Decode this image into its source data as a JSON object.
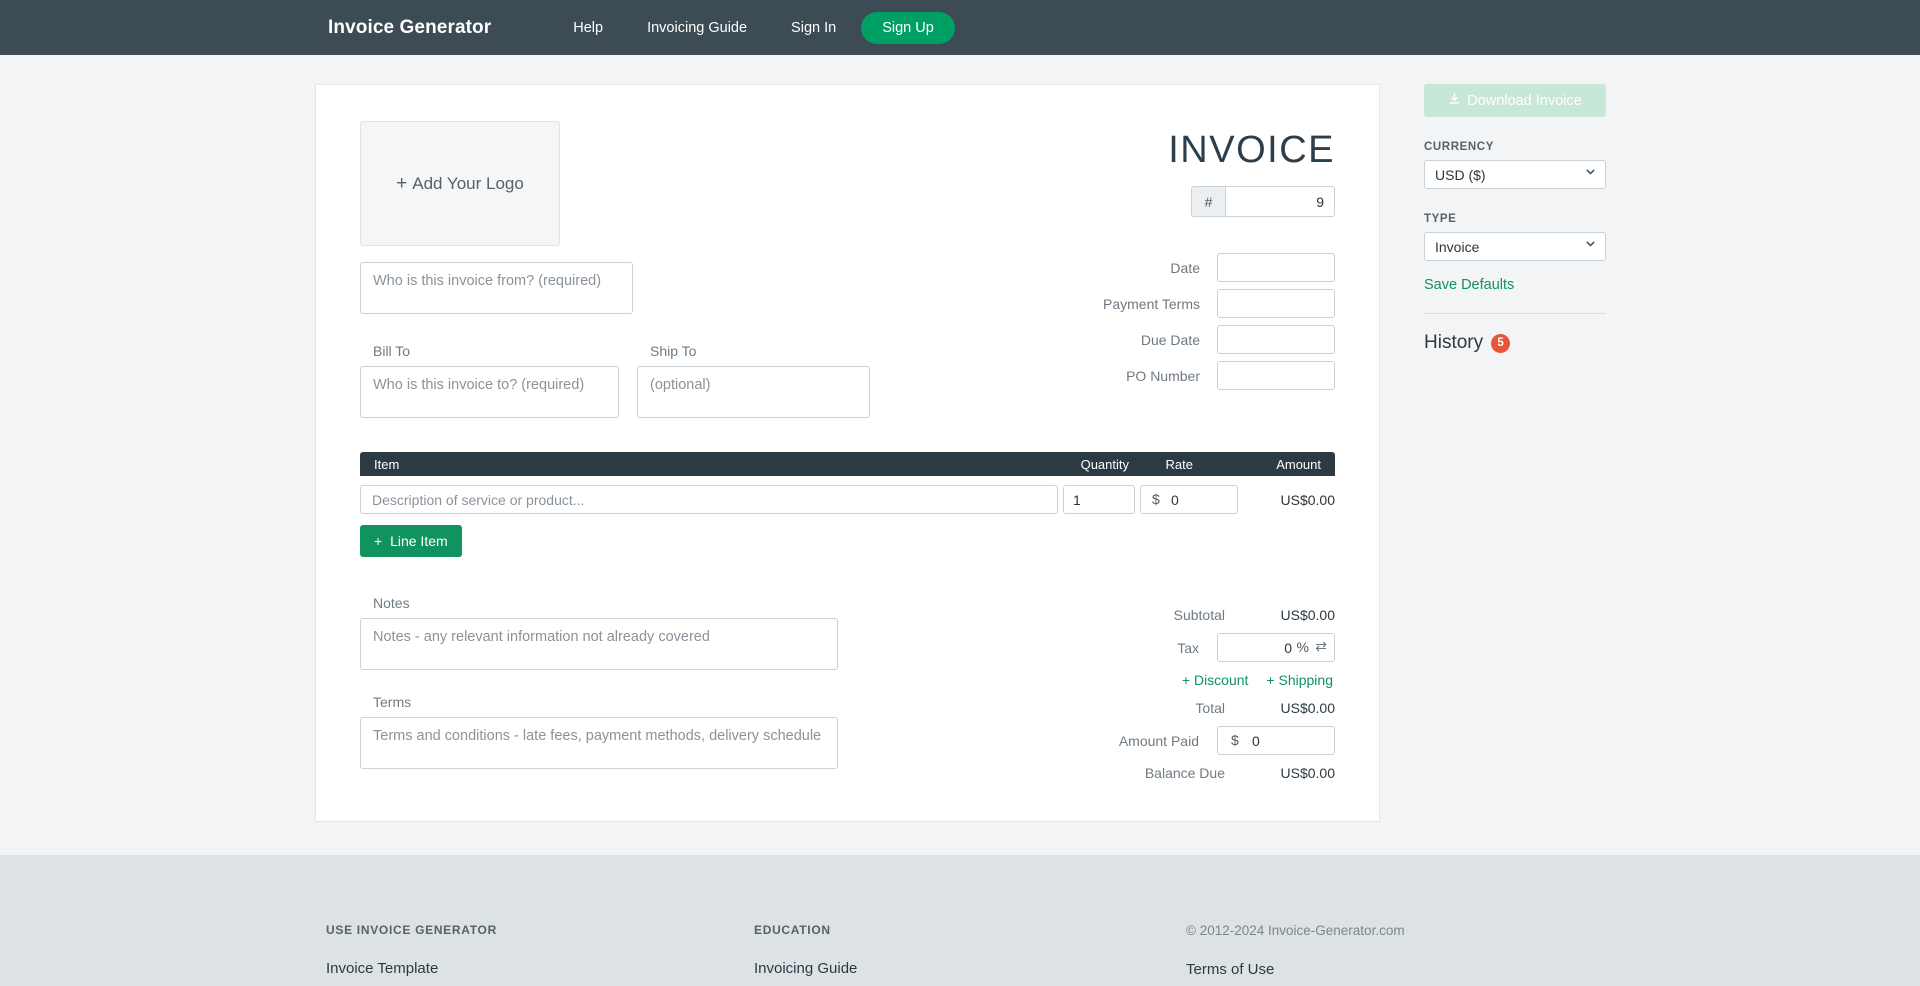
{
  "nav": {
    "brand": "Invoice Generator",
    "links": [
      {
        "label": "Help"
      },
      {
        "label": "Invoicing Guide"
      },
      {
        "label": "Sign In"
      }
    ],
    "signup_label": "Sign Up",
    "accent_green": "#00a064",
    "bar_color": "#3c4b54"
  },
  "invoice": {
    "logo_placeholder": "Add Your Logo",
    "logo_plus": "+",
    "from_placeholder": "Who is this invoice from? (required)",
    "bill_to_label": "Bill To",
    "bill_to_placeholder": "Who is this invoice to? (required)",
    "ship_to_label": "Ship To",
    "ship_to_placeholder": "(optional)",
    "title": "INVOICE",
    "number_prefix": "#",
    "number_value": "9",
    "dates": [
      {
        "label": "Date",
        "value": ""
      },
      {
        "label": "Payment Terms",
        "value": ""
      },
      {
        "label": "Due Date",
        "value": ""
      },
      {
        "label": "PO Number",
        "value": ""
      }
    ],
    "table": {
      "headers": {
        "item": "Item",
        "quantity": "Quantity",
        "rate": "Rate",
        "amount": "Amount"
      },
      "rows": [
        {
          "description_placeholder": "Description of service or product...",
          "quantity": "1",
          "rate_currency": "$",
          "rate": "0",
          "amount": "US$0.00"
        }
      ],
      "add_line_item_label": "Line Item",
      "add_line_item_plus": "+"
    },
    "notes_label": "Notes",
    "notes_placeholder": "Notes - any relevant information not already covered",
    "terms_label": "Terms",
    "terms_placeholder": "Terms and conditions - late fees, payment methods, delivery schedule",
    "totals": {
      "subtotal_label": "Subtotal",
      "subtotal_value": "US$0.00",
      "tax_label": "Tax",
      "tax_value": "0",
      "tax_unit": "%",
      "tax_swap_icon": "⇄",
      "discount_label": "Discount",
      "discount_plus": "+",
      "shipping_label": "Shipping",
      "shipping_plus": "+",
      "total_label": "Total",
      "total_value": "US$0.00",
      "amount_paid_label": "Amount Paid",
      "amount_paid_currency": "$",
      "amount_paid_value": "0",
      "balance_due_label": "Balance Due",
      "balance_due_value": "US$0.00"
    }
  },
  "sidebar": {
    "download_label": "Download Invoice",
    "download_icon": "download-icon",
    "currency_label": "CURRENCY",
    "currency_value": "USD ($)",
    "type_label": "TYPE",
    "type_value": "Invoice",
    "save_defaults_label": "Save Defaults",
    "history_label": "History",
    "history_count": "5",
    "history_badge_color": "#e8553a"
  },
  "footer": {
    "col1_heading": "USE INVOICE GENERATOR",
    "col1_link": "Invoice Template",
    "col2_heading": "EDUCATION",
    "col2_link": "Invoicing Guide",
    "copyright": "© 2012-2024 Invoice-Generator.com",
    "col3_link": "Terms of Use"
  }
}
